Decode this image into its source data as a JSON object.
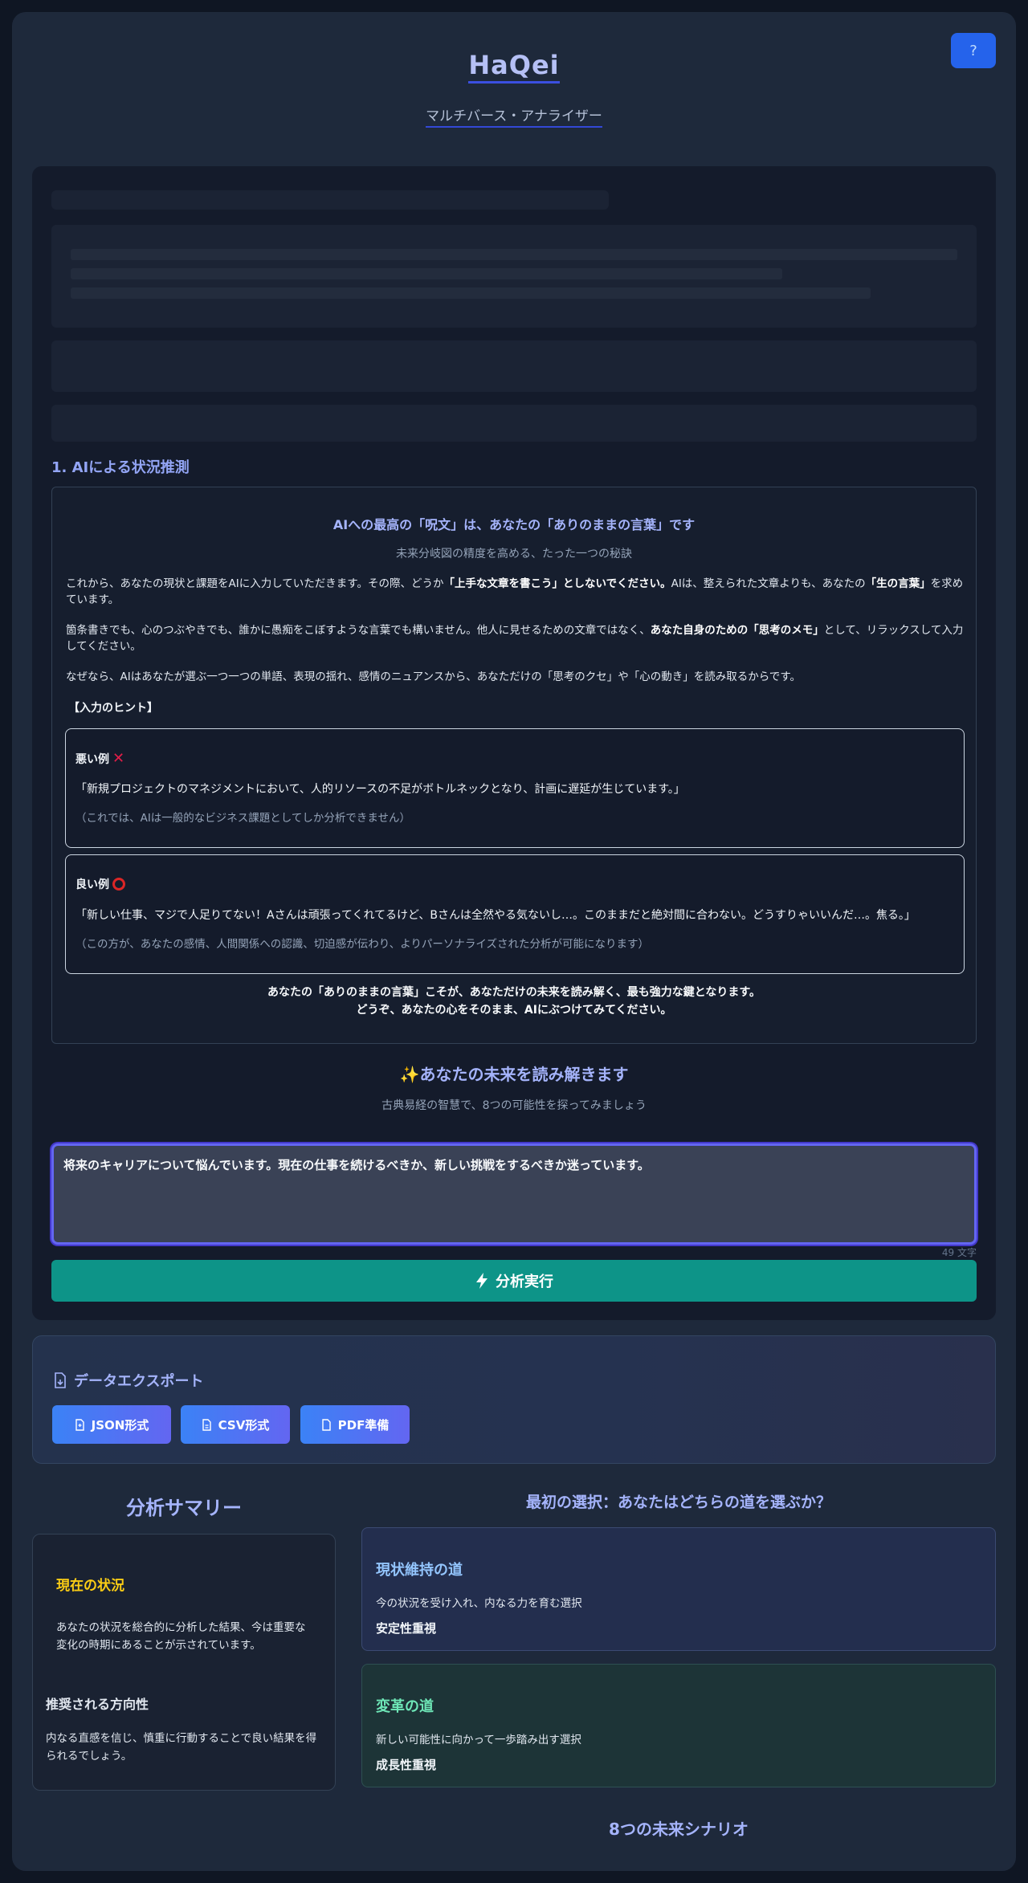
{
  "header": {
    "help_icon_label": "?",
    "title": "HaQei",
    "subtitle": "マルチバース・アナライザー"
  },
  "section1": {
    "heading": "1. AIによる状況推測",
    "info_title": "AIへの最高の「呪文」は、あなたの「ありのままの言葉」です",
    "info_subtitle": "未来分岐図の精度を高める、たった一つの秘訣",
    "p1_a": "これから、あなたの現状と課題をAIに入力していただきます。その際、どうか",
    "p1_b": "「上手な文章を書こう」としないでください。",
    "p1_c": "AIは、整えられた文章よりも、あなたの",
    "p1_d": "「生の言葉」",
    "p1_e": "を求めています。",
    "p2_a": "箇条書きでも、心のつぶやきでも、誰かに愚痴をこぼすような言葉でも構いません。他人に見せるための文章ではなく、",
    "p2_b": "あなた自身のための「思考のメモ」",
    "p2_c": "として、リラックスして入力してください。",
    "p3": "なぜなら、AIはあなたが選ぶ一つ一つの単語、表現の揺れ、感情のニュアンスから、あなただけの「思考のクセ」や「心の動き」を読み取るからです。",
    "hint_label": "【入力のヒント】",
    "bad_example": {
      "label": "悪い例",
      "quote": "「新規プロジェクトのマネジメントにおいて、人的リソースの不足がボトルネックとなり、計画に遅延が生じています。」",
      "note": "（これでは、AIは一般的なビジネス課題としてしか分析できません）"
    },
    "good_example": {
      "label": "良い例",
      "quote": "「新しい仕事、マジで人足りてない！Aさんは頑張ってくれてるけど、Bさんは全然やる気ないし…。このままだと絶対間に合わない。どうすりゃいいんだ…。焦る。」",
      "note": "（この方が、あなたの感情、人間関係への認識、切迫感が伝わり、よりパーソナライズされた分析が可能になります）"
    },
    "closing_line1": "あなたの「ありのままの言葉」こそが、あなただけの未来を読み解く、最も強力な鍵となります。",
    "closing_line2": "どうぞ、あなたの心をそのまま、AIにぶつけてみてください。"
  },
  "analysis": {
    "title": "✨あなたの未来を読み解きます",
    "subtitle": "古典易経の智慧で、8つの可能性を探ってみましょう",
    "input_value": "将来のキャリアについて悩んでいます。現在の仕事を続けるべきか、新しい挑戦をするべきか迷っています。",
    "char_count": "49 文字",
    "run_button": "分析実行"
  },
  "export": {
    "title": "データエクスポート",
    "json_button": "JSON形式",
    "csv_button": "CSV形式",
    "pdf_button": "PDF準備"
  },
  "summary": {
    "title": "分析サマリー",
    "current_title": "現在の状況",
    "current_text": "あなたの状況を総合的に分析した結果、今は重要な変化の時期にあることが示されています。",
    "direction_title": "推奨される方向性",
    "direction_text": "内なる直感を信じ、慎重に行動することで良い結果を得られるでしょう。"
  },
  "choice": {
    "title": "最初の選択：あなたはどちらの道を選ぶか？",
    "stay": {
      "title": "現状維持の道",
      "desc": "今の状況を受け入れ、内なる力を育む選択",
      "tag": "安定性重視"
    },
    "change": {
      "title": "変革の道",
      "desc": "新しい可能性に向かって一歩踏み出す選択",
      "tag": "成長性重視"
    }
  },
  "scenarios": {
    "title": "8つの未来シナリオ"
  },
  "colors": {
    "accent": "#a5b4fc",
    "run_button": "#0d9488",
    "help_button": "#2563eb",
    "current_title": "#facc15",
    "change_title": "#6ee7b7"
  }
}
